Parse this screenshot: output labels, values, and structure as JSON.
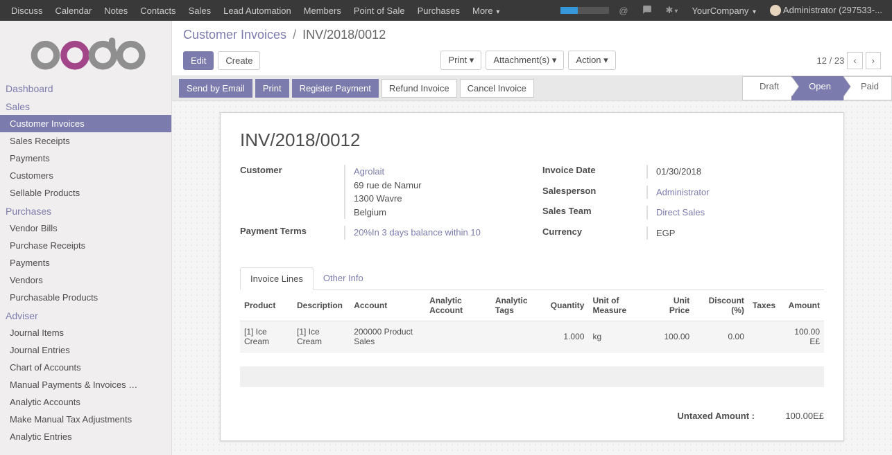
{
  "navbar": {
    "menu": [
      "Discuss",
      "Calendar",
      "Notes",
      "Contacts",
      "Sales",
      "Lead Automation",
      "Members",
      "Point of Sale",
      "Purchases",
      "More"
    ],
    "company": "YourCompany",
    "user": "Administrator (297533-..."
  },
  "sidebar": {
    "sections": [
      {
        "title": "Dashboard",
        "items": []
      },
      {
        "title": "Sales",
        "items": [
          {
            "label": "Customer Invoices",
            "active": true
          },
          {
            "label": "Sales Receipts"
          },
          {
            "label": "Payments"
          },
          {
            "label": "Customers"
          },
          {
            "label": "Sellable Products"
          }
        ]
      },
      {
        "title": "Purchases",
        "items": [
          {
            "label": "Vendor Bills"
          },
          {
            "label": "Purchase Receipts"
          },
          {
            "label": "Payments"
          },
          {
            "label": "Vendors"
          },
          {
            "label": "Purchasable Products"
          }
        ]
      },
      {
        "title": "Adviser",
        "items": [
          {
            "label": "Journal Items"
          },
          {
            "label": "Journal Entries"
          },
          {
            "label": "Chart of Accounts"
          },
          {
            "label": "Manual Payments & Invoices …"
          },
          {
            "label": "Analytic Accounts"
          },
          {
            "label": "Make Manual Tax Adjustments"
          },
          {
            "label": "Analytic Entries"
          }
        ]
      }
    ]
  },
  "breadcrumb": {
    "parent": "Customer Invoices",
    "current": "INV/2018/0012"
  },
  "toolbar": {
    "edit": "Edit",
    "create": "Create",
    "print": "Print",
    "attachments": "Attachment(s)",
    "action": "Action",
    "pager": "12 / 23"
  },
  "status_actions": {
    "send": "Send by Email",
    "print": "Print",
    "register": "Register Payment",
    "refund": "Refund Invoice",
    "cancel": "Cancel Invoice"
  },
  "stages": [
    {
      "label": "Draft"
    },
    {
      "label": "Open",
      "active": true
    },
    {
      "label": "Paid"
    }
  ],
  "invoice": {
    "title": "INV/2018/0012",
    "customer_label": "Customer",
    "customer_name": "Agrolait",
    "customer_addr1": "69 rue de Namur",
    "customer_addr2": "1300 Wavre",
    "customer_country": "Belgium",
    "payment_terms_label": "Payment Terms",
    "payment_terms": "20%In 3 days balance within 10",
    "date_label": "Invoice Date",
    "date": "01/30/2018",
    "salesperson_label": "Salesperson",
    "salesperson": "Administrator",
    "team_label": "Sales Team",
    "team": "Direct Sales",
    "currency_label": "Currency",
    "currency": "EGP"
  },
  "tabs": {
    "lines": "Invoice Lines",
    "other": "Other Info"
  },
  "columns": {
    "product": "Product",
    "description": "Description",
    "account": "Account",
    "analytic_account": "Analytic Account",
    "analytic_tags": "Analytic Tags",
    "quantity": "Quantity",
    "uom": "Unit of Measure",
    "unit_price": "Unit Price",
    "discount": "Discount (%)",
    "taxes": "Taxes",
    "amount": "Amount"
  },
  "lines": [
    {
      "product": "[1] Ice Cream",
      "description": "[1] Ice Cream",
      "account": "200000 Product Sales",
      "analytic_account": "",
      "analytic_tags": "",
      "quantity": "1.000",
      "uom": "kg",
      "unit_price": "100.00",
      "discount": "0.00",
      "taxes": "",
      "amount": "100.00 E£"
    }
  ],
  "totals": {
    "untaxed_label": "Untaxed Amount :",
    "untaxed": "100.00E£"
  }
}
